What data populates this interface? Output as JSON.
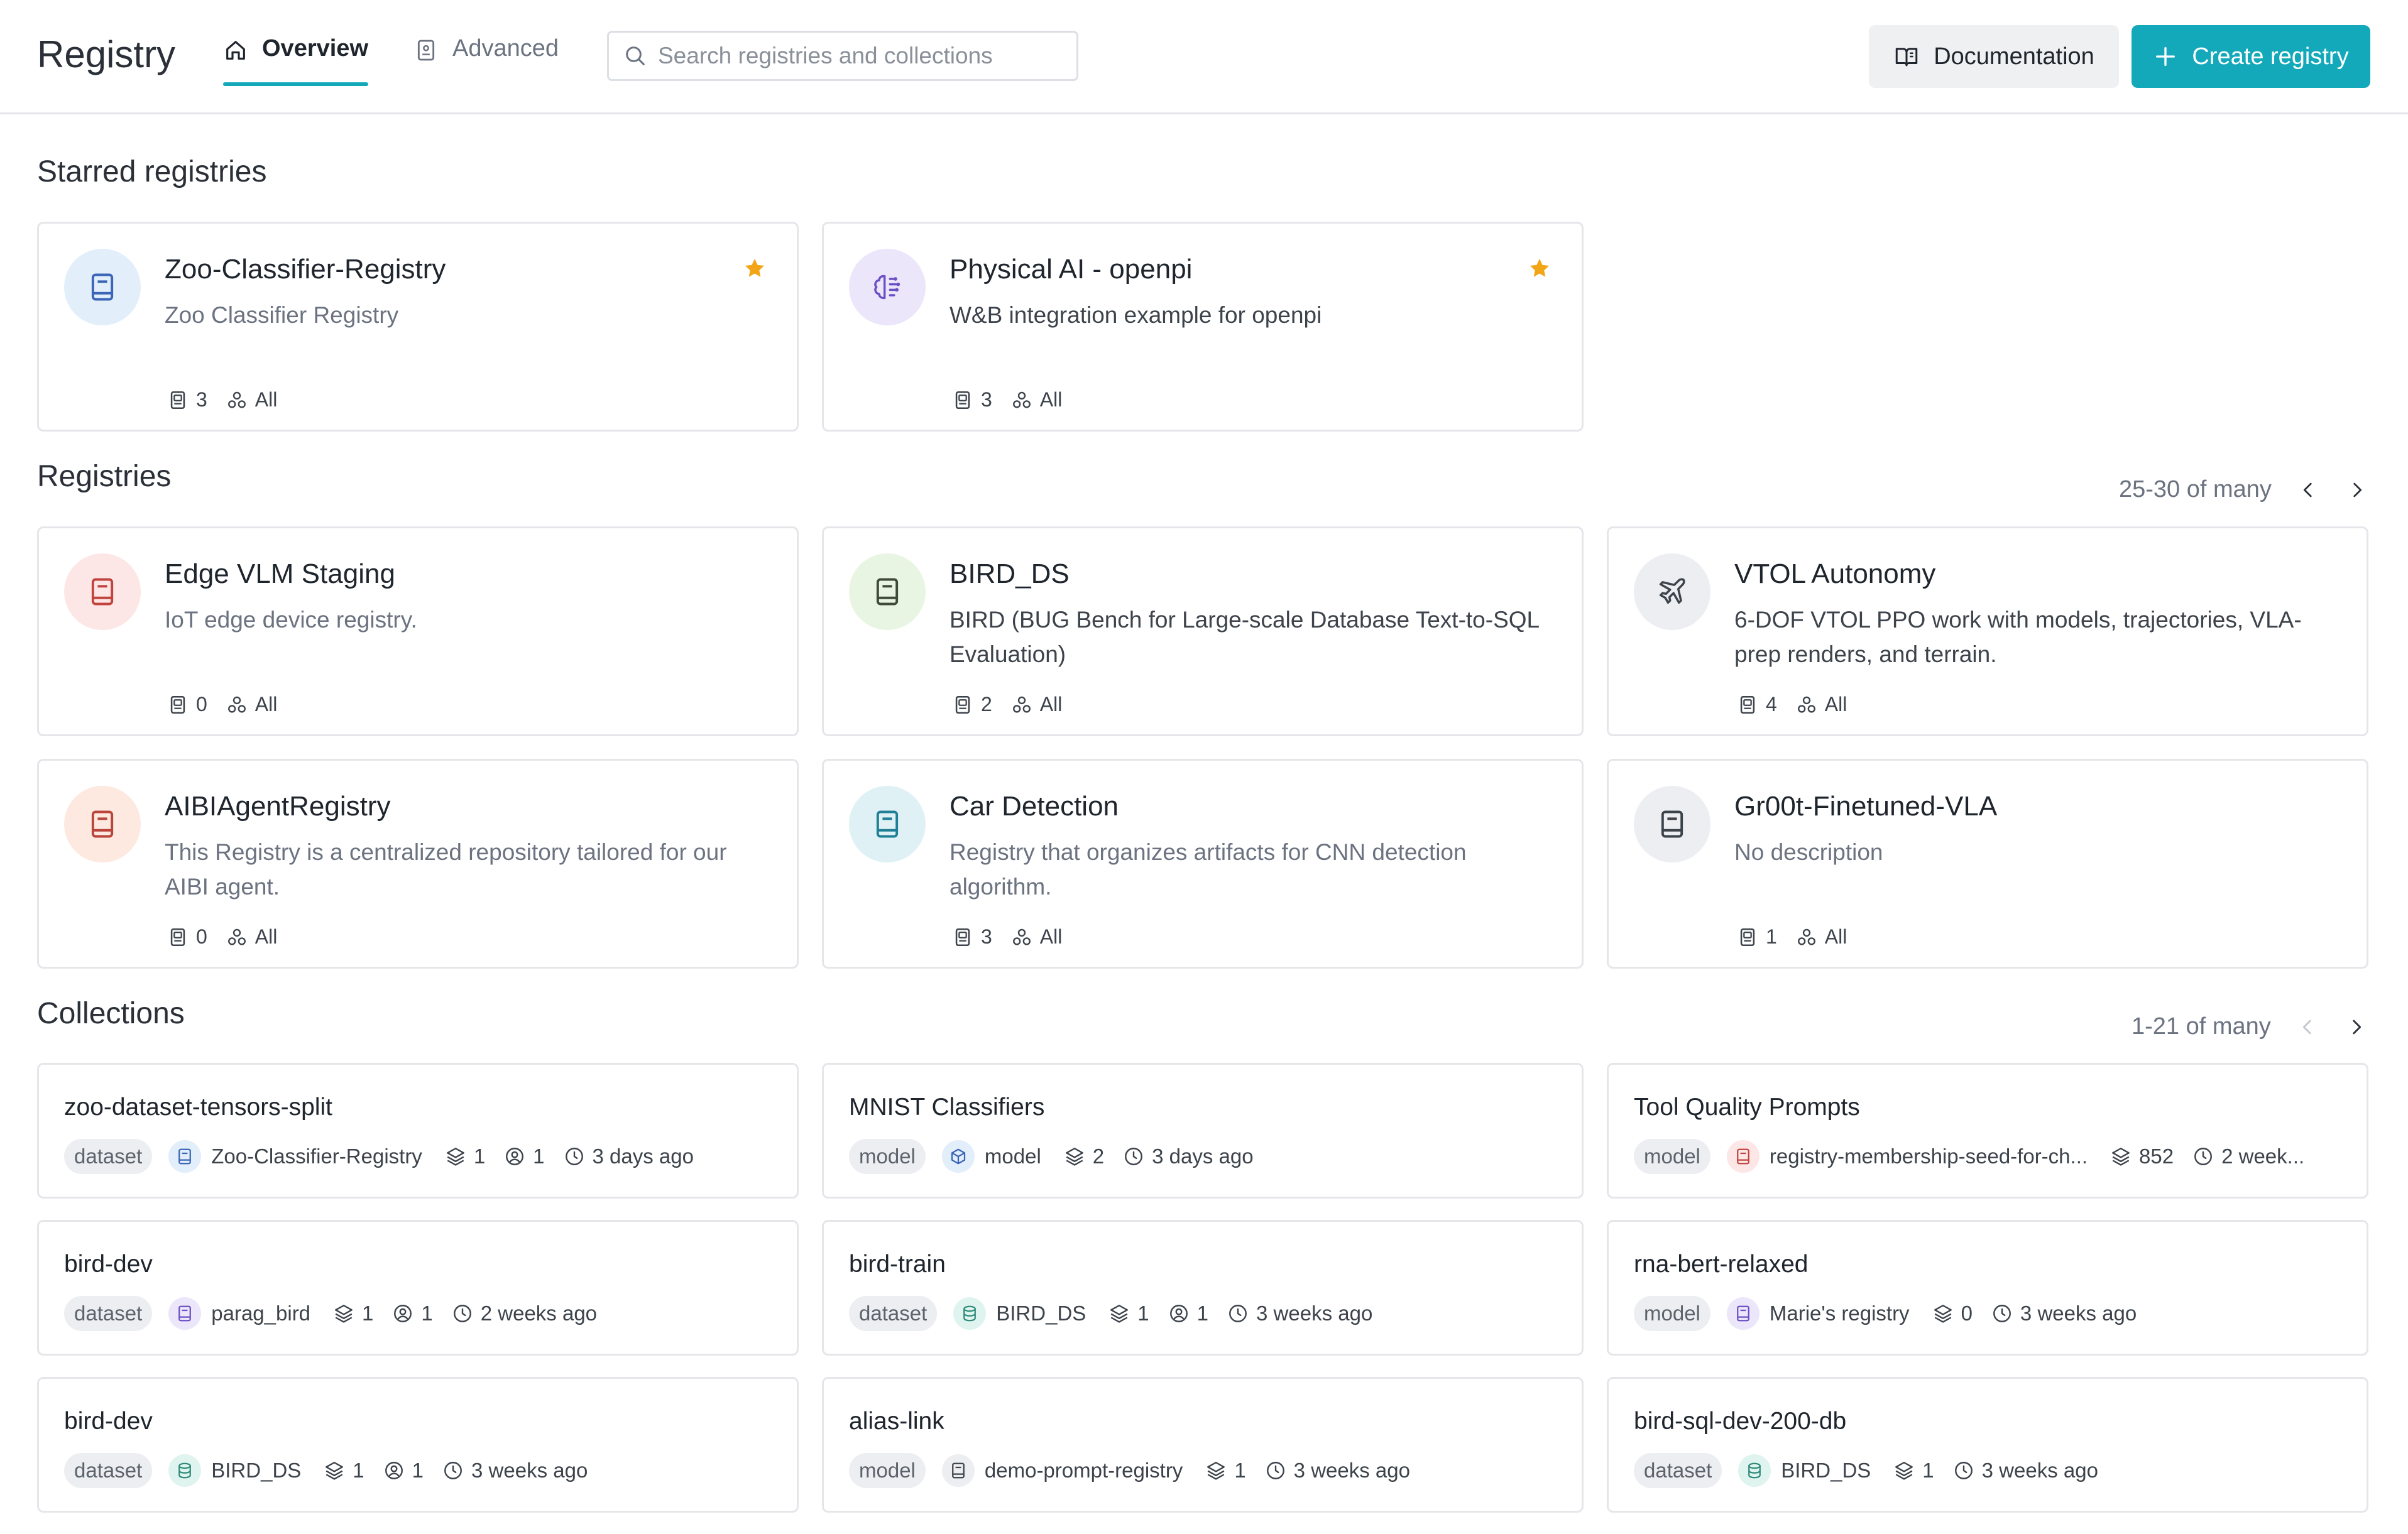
{
  "header": {
    "title": "Registry",
    "tabs": [
      {
        "label": "Overview",
        "active": true
      },
      {
        "label": "Advanced",
        "active": false
      }
    ],
    "search_placeholder": "Search registries and collections",
    "documentation_label": "Documentation",
    "create_label": "Create registry"
  },
  "colors": {
    "accent": "#13a9ba",
    "star": "#f2a516"
  },
  "starred": {
    "title": "Starred registries",
    "cards": [
      {
        "name": "Zoo-Classifier-Registry",
        "description": "Zoo Classifier Registry",
        "collections": "3",
        "visibility": "All",
        "icon": "book-icon",
        "starred": true
      },
      {
        "name": "Physical AI - openpi",
        "description": "W&B integration example for openpi",
        "collections": "3",
        "visibility": "All",
        "icon": "brain-icon",
        "starred": true
      }
    ]
  },
  "registries": {
    "title": "Registries",
    "pagination": "25-30 of many",
    "cards": [
      {
        "name": "Edge VLM Staging",
        "description": "IoT edge device registry.",
        "collections": "0",
        "visibility": "All",
        "icon": "book-icon"
      },
      {
        "name": "BIRD_DS",
        "description": "BIRD (BUG Bench for Large-scale Database Text-to-SQL Evaluation)",
        "collections": "2",
        "visibility": "All",
        "icon": "book-icon"
      },
      {
        "name": "VTOL Autonomy",
        "description": "6-DOF VTOL PPO work with models, trajectories, VLA-prep renders, and terrain.",
        "collections": "4",
        "visibility": "All",
        "icon": "plane-icon"
      },
      {
        "name": "AIBIAgentRegistry",
        "description": "This Registry is a centralized repository tailored for our AIBI agent.",
        "collections": "0",
        "visibility": "All",
        "icon": "book-icon"
      },
      {
        "name": "Car Detection",
        "description": "Registry that organizes artifacts for CNN detection algorithm.",
        "collections": "3",
        "visibility": "All",
        "icon": "book-icon"
      },
      {
        "name": "Gr00t-Finetuned-VLA",
        "description": "No description",
        "collections": "1",
        "visibility": "All",
        "icon": "book-icon"
      }
    ]
  },
  "collections": {
    "title": "Collections",
    "pagination": "1-21 of many",
    "items": [
      {
        "name": "zoo-dataset-tensors-split",
        "type": "dataset",
        "registry": "Zoo-Classifier-Registry",
        "versions": "1",
        "users": "1",
        "updated": "3 days ago"
      },
      {
        "name": "MNIST Classifiers",
        "type": "model",
        "registry": "model",
        "versions": "2",
        "updated": "3 days ago"
      },
      {
        "name": "Tool Quality Prompts",
        "type": "model",
        "registry": "registry-membership-seed-for-ch...",
        "versions": "852",
        "updated": "2 week..."
      },
      {
        "name": "bird-dev",
        "type": "dataset",
        "registry": "parag_bird",
        "versions": "1",
        "users": "1",
        "updated": "2 weeks ago"
      },
      {
        "name": "bird-train",
        "type": "dataset",
        "registry": "BIRD_DS",
        "versions": "1",
        "users": "1",
        "updated": "3 weeks ago"
      },
      {
        "name": "rna-bert-relaxed",
        "type": "model",
        "registry": "Marie's registry",
        "versions": "0",
        "updated": "3 weeks ago"
      },
      {
        "name": "bird-dev",
        "type": "dataset",
        "registry": "BIRD_DS",
        "versions": "1",
        "users": "1",
        "updated": "3 weeks ago"
      },
      {
        "name": "alias-link",
        "type": "model",
        "registry": "demo-prompt-registry",
        "versions": "1",
        "updated": "3 weeks ago"
      },
      {
        "name": "bird-sql-dev-200-db",
        "type": "dataset",
        "registry": "BIRD_DS",
        "versions": "1",
        "updated": "3 weeks ago"
      }
    ]
  }
}
